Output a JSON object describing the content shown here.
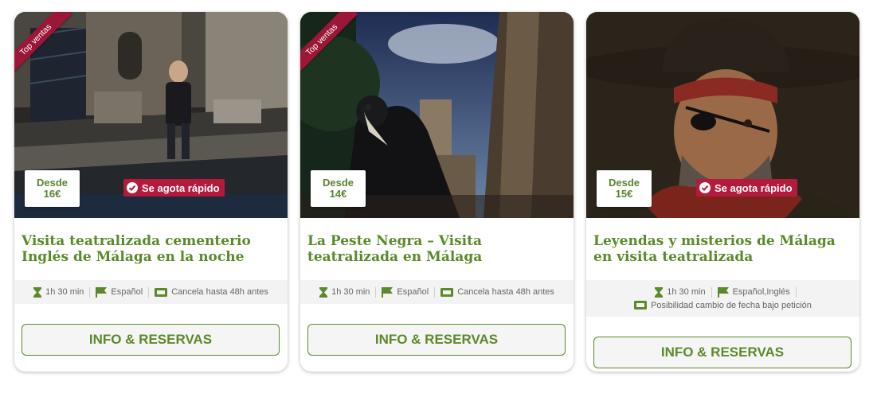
{
  "colors": {
    "accent_green": "#5a8a2a",
    "badge_red": "#b41a3c",
    "ribbon_red": "#9c1638"
  },
  "cards": [
    {
      "ribbon": "Top ventas",
      "price_label": "Desde",
      "price": "16€",
      "sell_fast": "Se agota rápido",
      "title": "Visita teatralizada cementerio Inglés de Málaga en la noche",
      "duration": "1h 30 min",
      "language": "Español",
      "extra": "Cancela hasta 48h antes",
      "button": "INFO & RESERVAS"
    },
    {
      "ribbon": "Top ventas",
      "price_label": "Desde",
      "price": "14€",
      "title": "La Peste Negra – Visita teatralizada en Málaga",
      "duration": "1h 30 min",
      "language": "Español",
      "extra": "Cancela hasta 48h antes",
      "button": "INFO & RESERVAS"
    },
    {
      "price_label": "Desde",
      "price": "15€",
      "sell_fast": "Se agota rápido",
      "title": "Leyendas y misterios de Málaga en visita teatralizada",
      "duration": "1h 30 min",
      "language": "Español,Inglés",
      "extra": "Posibilidad cambio de fecha bajo petición",
      "button": "INFO & RESERVAS"
    }
  ]
}
